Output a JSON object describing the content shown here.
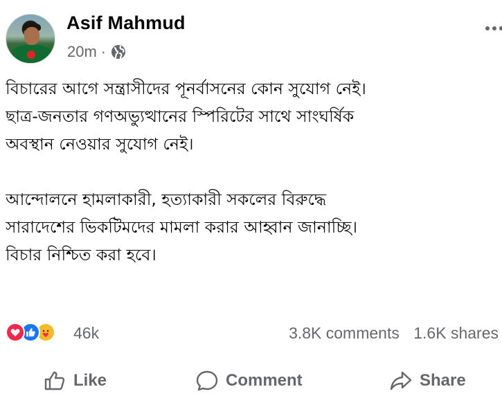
{
  "post": {
    "author": "Asif Mahmud",
    "time": "20m",
    "separator": "·",
    "audience_icon": "globe-icon",
    "paragraphs": [
      [
        "বিচারের আগে সন্ত্রাসীদের পূনর্বাসনের কোন সুযোগ নেই।",
        "ছাত্র-জনতার গণঅভ্যুত্থানের স্পিরিটের সাথে সাংঘর্ষিক",
        "অবস্থান নেওয়ার সুযোগ নেই।"
      ],
      [
        "আন্দোলনে হামলাকারী, হত্যাকারী সকলের বিরুদ্ধে",
        "সারাদেশের ভিকটিমদের মামলা করার আহ্বান জানাচ্ছি।",
        "বিচার নিশ্চিত করা হবে।"
      ]
    ]
  },
  "stats": {
    "reactions": [
      "love-icon",
      "like-icon",
      "care-icon"
    ],
    "reaction_count": "46k",
    "comments": "3.8K comments",
    "shares": "1.6K shares"
  },
  "actions": {
    "like": "Like",
    "comment": "Comment",
    "share": "Share"
  },
  "colors": {
    "secondary_text": "#65676b",
    "love": "#f0284a",
    "like": "#1877f2",
    "care": "#f7b928"
  }
}
